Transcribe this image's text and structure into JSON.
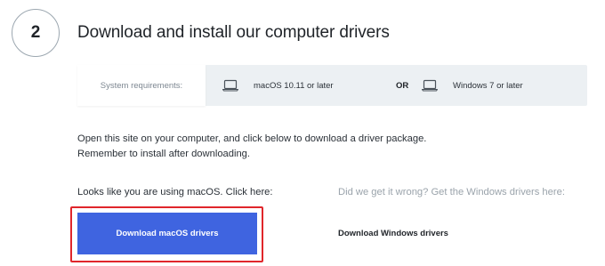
{
  "step": {
    "number": "2",
    "title": "Download and install our computer drivers"
  },
  "requirements": {
    "label": "System requirements:",
    "mac": "macOS 10.11 or later",
    "or": "OR",
    "windows": "Windows 7 or later",
    "icons": [
      "laptop-icon",
      "laptop-icon"
    ]
  },
  "instructions": {
    "line1": "Open this site on your computer, and click below to download a driver package.",
    "line2": "Remember to install after downloading."
  },
  "detected": {
    "text": "Looks like you are using macOS. Click here:",
    "button_label": "Download macOS drivers"
  },
  "alternate": {
    "text": "Did we get it wrong? Get the Windows drivers here:",
    "link_label": "Download Windows drivers"
  },
  "colors": {
    "primary_button": "#3f64e0",
    "highlight_border": "#e0262b",
    "requirements_background": "#ecf0f3"
  }
}
